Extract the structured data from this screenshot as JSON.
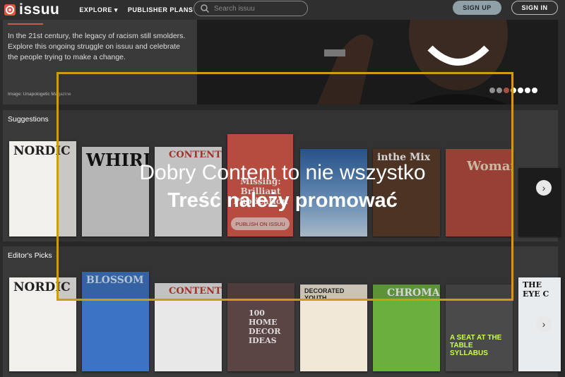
{
  "header": {
    "logo_text": "issuu",
    "nav": [
      "EXPLORE ▾",
      "PUBLISHER PLANS"
    ],
    "search_placeholder": "Search issuu",
    "signup_label": "SIGN UP",
    "signin_label": "SIGN IN"
  },
  "hero": {
    "text": "In the 21st century, the legacy of racism still smolders. Explore this ongoing struggle on issuu and celebrate the people trying to make a change.",
    "credit": "Image: Unapologetic Magazine"
  },
  "suggestions": {
    "title": "Suggestions",
    "covers": [
      "NORDIC",
      "WHIRL",
      "CONTENT",
      "Missing: Brilliant Publication",
      "",
      "inthe Mix",
      "Woman",
      ""
    ],
    "cta": "PUBLISH ON ISSUU"
  },
  "editors": {
    "title": "Editor's Picks",
    "covers": [
      "NORDIC",
      "BLOSSOM",
      "CONTENT",
      "100 HOME DECOR IDEAS",
      "DECORATED YOUTH",
      "CHROMA",
      "A SEAT AT THE TABLE SYLLABUS",
      "THE EYE C"
    ]
  },
  "overlay": {
    "line1": "Dobry Content to nie wszystko",
    "line2": "Treść należy promować"
  },
  "colors": {
    "accent": "#d09a14",
    "brand": "#c8473a"
  }
}
